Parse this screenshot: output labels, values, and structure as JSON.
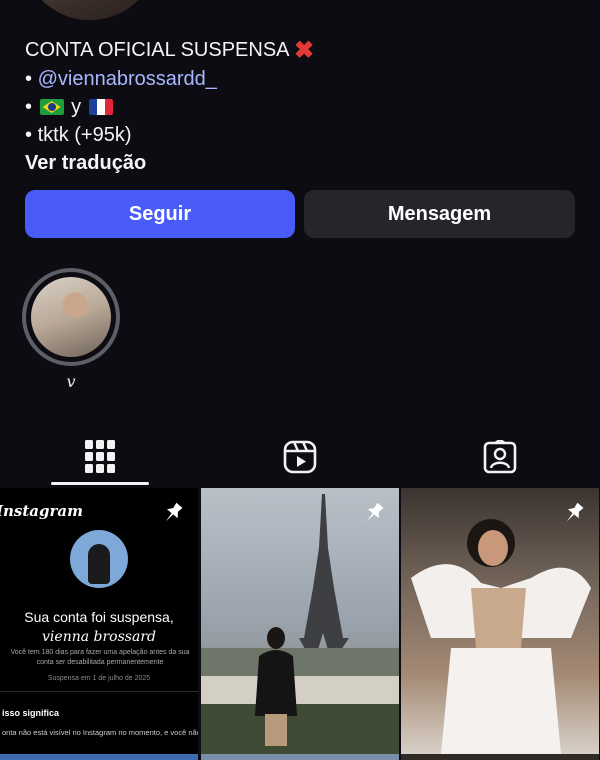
{
  "profile": {
    "bio": {
      "line1": "CONTA OFICIAL SUSPENSA",
      "line1_emoji": "cross-mark",
      "bullet": "•",
      "handle": "@viennabrossardd_",
      "flags_connector": "y",
      "flags": [
        "brazil-flag",
        "france-flag"
      ],
      "line4": "tktk (+95k)",
      "translate": "Ver tradução"
    },
    "buttons": {
      "follow": "Seguir",
      "message": "Mensagem"
    }
  },
  "highlights": [
    {
      "label": "v"
    }
  ],
  "tabs": [
    {
      "name": "posts-grid-tab",
      "icon": "grid-icon",
      "active": true
    },
    {
      "name": "reels-tab",
      "icon": "reels-icon",
      "active": false
    },
    {
      "name": "tagged-tab",
      "icon": "tagged-person-icon",
      "active": false
    }
  ],
  "posts": {
    "post1": {
      "pinned": true,
      "brand": "Instagram",
      "title": "Sua conta foi suspensa,",
      "title_name": "vienna brossard",
      "body": "Você tem 180 dias para fazer uma apelação antes da sua conta ser desabilitada permanentemente",
      "date": "Suspensa em 1 de julho de 2025",
      "heading": "isso significa",
      "text": "onta não está visível no Instagram no momento, e você não"
    },
    "post2": {
      "pinned": true
    },
    "post3": {
      "pinned": true
    }
  },
  "colors": {
    "accent": "#4a5cf7",
    "background": "#0c0c12",
    "link": "#a9b7ff",
    "secondary_button": "#25262b"
  }
}
